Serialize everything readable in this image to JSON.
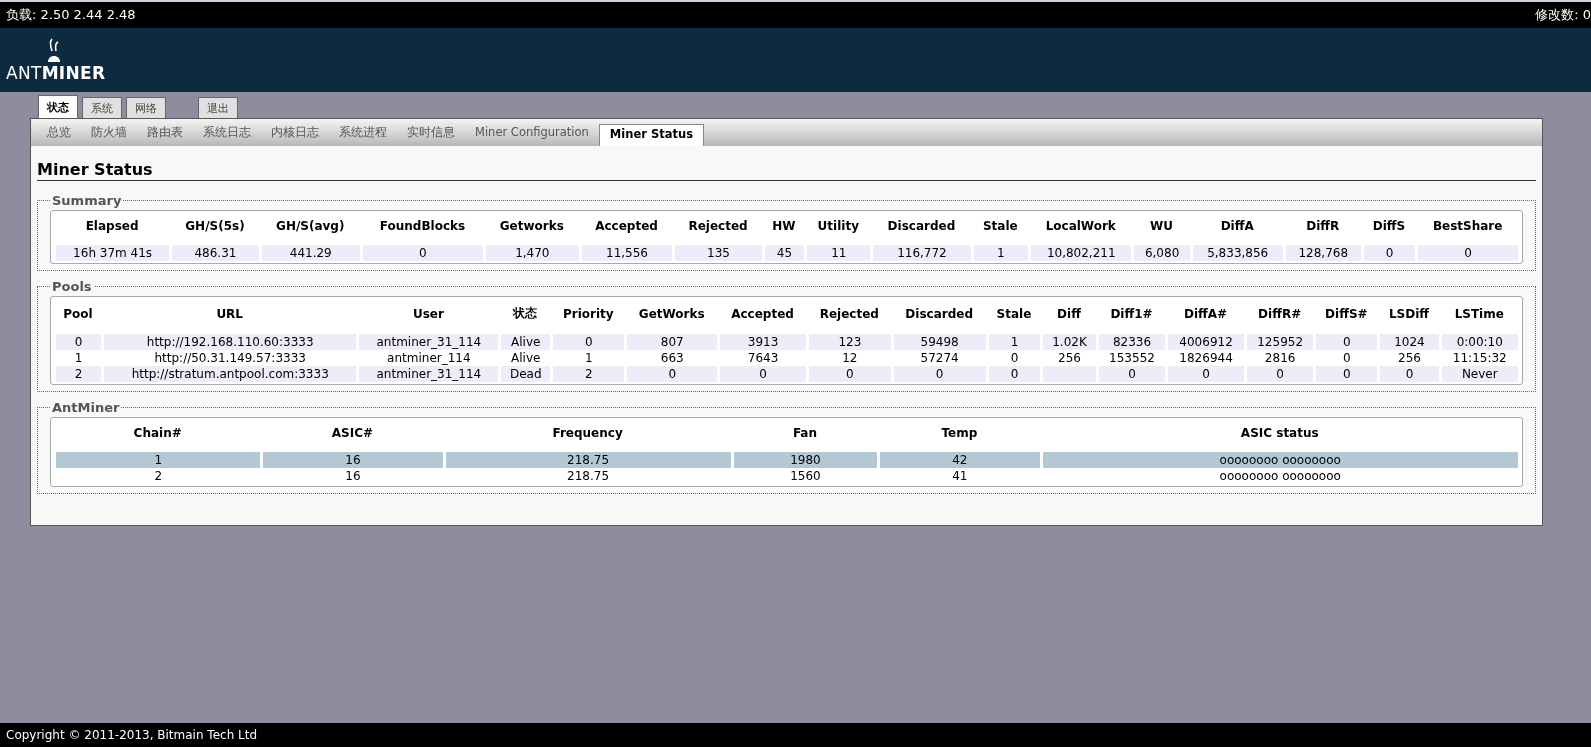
{
  "top_bar": {
    "load": "负载: 2.50 2.44 2.48",
    "changes": "修改数: 0"
  },
  "logo": {
    "text_light": "ANT",
    "text_bold": "MINER"
  },
  "main_tabs": [
    {
      "label": "状态",
      "selected": true
    },
    {
      "label": "系统",
      "selected": false
    },
    {
      "label": "网络",
      "selected": false
    },
    {
      "label": "退出",
      "selected": false
    }
  ],
  "sub_tabs": [
    {
      "label": "总览",
      "selected": false
    },
    {
      "label": "防火墙",
      "selected": false
    },
    {
      "label": "路由表",
      "selected": false
    },
    {
      "label": "系统日志",
      "selected": false
    },
    {
      "label": "内核日志",
      "selected": false
    },
    {
      "label": "系统进程",
      "selected": false
    },
    {
      "label": "实时信息",
      "selected": false
    },
    {
      "label": "Miner Configuration",
      "selected": false
    },
    {
      "label": "Miner Status",
      "selected": true
    }
  ],
  "page_title": "Miner Status",
  "sections": [
    {
      "title": "Summary",
      "columns": [
        "Elapsed",
        "GH/S(5s)",
        "GH/S(avg)",
        "FoundBlocks",
        "Getworks",
        "Accepted",
        "Rejected",
        "HW",
        "Utility",
        "Discarded",
        "Stale",
        "LocalWork",
        "WU",
        "DiffA",
        "DiffR",
        "DiffS",
        "BestShare"
      ],
      "rows": [
        {
          "selected": false,
          "cells": [
            "16h 37m 41s",
            "486.31",
            "441.29",
            "0",
            "1,470",
            "11,556",
            "135",
            "45",
            "11",
            "116,772",
            "1",
            "10,802,211",
            "6,080",
            "5,833,856",
            "128,768",
            "0",
            "0"
          ]
        }
      ]
    },
    {
      "title": "Pools",
      "columns": [
        "Pool",
        "URL",
        "User",
        "状态",
        "Priority",
        "GetWorks",
        "Accepted",
        "Rejected",
        "Discarded",
        "Stale",
        "Diff",
        "Diff1#",
        "DiffA#",
        "DiffR#",
        "DiffS#",
        "LSDiff",
        "LSTime"
      ],
      "rows": [
        {
          "selected": false,
          "cells": [
            "0",
            "http://192.168.110.60:3333",
            "antminer_31_114",
            "Alive",
            "0",
            "807",
            "3913",
            "123",
            "59498",
            "1",
            "1.02K",
            "82336",
            "4006912",
            "125952",
            "0",
            "1024",
            "0:00:10"
          ]
        },
        {
          "selected": false,
          "cells": [
            "1",
            "http://50.31.149.57:3333",
            "antminer_114",
            "Alive",
            "1",
            "663",
            "7643",
            "12",
            "57274",
            "0",
            "256",
            "153552",
            "1826944",
            "2816",
            "0",
            "256",
            "11:15:32"
          ]
        },
        {
          "selected": false,
          "cells": [
            "2",
            "http://stratum.antpool.com:3333",
            "antminer_31_114",
            "Dead",
            "2",
            "0",
            "0",
            "0",
            "0",
            "0",
            null,
            "0",
            "0",
            "0",
            "0",
            "0",
            "Never"
          ]
        }
      ]
    },
    {
      "title": "AntMiner",
      "columns": [
        "Chain#",
        "ASIC#",
        "Frequency",
        "Fan",
        "Temp",
        "ASIC status"
      ],
      "rows": [
        {
          "selected": true,
          "cells": [
            "1",
            "16",
            "218.75",
            "1980",
            "42",
            "oooooooo oooooooo"
          ]
        },
        {
          "selected": false,
          "cells": [
            "2",
            "16",
            "218.75",
            "1560",
            "41",
            "oooooooo oooooooo"
          ]
        }
      ]
    }
  ],
  "footer": "Copyright © 2011-2013, Bitmain Tech Ltd"
}
